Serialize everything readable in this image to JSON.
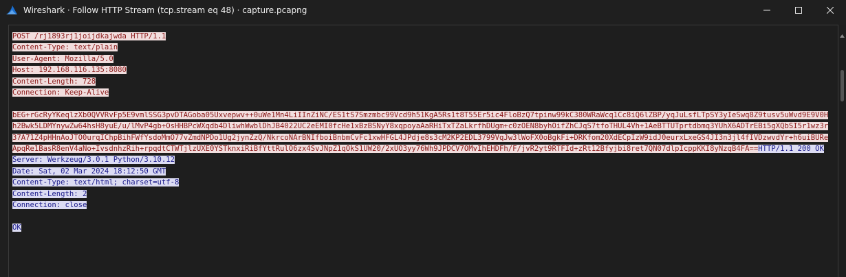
{
  "window": {
    "title": "Wireshark · Follow HTTP Stream (tcp.stream eq 48) · capture.pcapng",
    "icons": {
      "app": "wireshark-fin-icon",
      "minimize": "minimize-icon",
      "maximize": "maximize-icon",
      "close": "close-icon"
    }
  },
  "colors": {
    "client_bg": "#f1dede",
    "client_fg": "#8a1a1a",
    "server_bg": "#dcdcf3",
    "server_fg": "#1b1b8a",
    "window_bg": "#1f1f1f"
  },
  "stream": {
    "request_lines": [
      "POST /rj1893rj1joijdkajwda HTTP/1.1",
      "Content-Type: text/plain",
      "User-Agent: Mozilla/5.0",
      "Host: 192.168.116.135:8080",
      "Content-Length: 728",
      "Connection: Keep-Alive"
    ],
    "request_body": "bEG+rGcRyYKeqlzXb0QVVRvFp5E9vmlSSG3pvDTAGoba05Uxvepwv++0uWe1Mn4LiIInZiNC/ES1tS7Smzmbc99Vcd9h51KgA5Rs1t8T55Er5ic4FloBzQ7tpinw99kC380WRaWcq1Cc8iQ6lZBP/yqJuLsfLTpSY3yIeSwq8Z9tusv5uWvd9E9V0Hh2Bwk5LDMYnywZw64hsH8yuE/u/lMvP4gb+OsHHBPcWXqdb4DliwhWwblDhJB4022UC2eEMI0fcHe1xBzBSNyY8xqpoyaAaRHiTxTZaLkrfhDUgm+c0zOEN8byhOifZhCJqS7tfoTHUL4Vh+1AeBTTUTprtdbmq3YUhX6ADTrEBi5gXQbSI5r1wz3r37A71Z4pHHnAoJTO0urqIChpBihFWfYsdoMmO77vZmdNPDo1Ug2jynZzQ/NkrcoNArBNIfboiBnbmCvFc1xwHFGL4JPdje8s3cM2KP2EDL3799VqJw3lWoFX0oBgkFi+DRKfom20XdECpIzW9idJ0eurxLxeGS4JI3n3jl4fIVDzwvdYr+h6uiBUReApqRe1BasR8enV4aNo+IvsdnhzRih+rpqdtCTWTjlzUXE0YSTknxiRiBfYttRulO6zx4SvJNpZ1qOkS1UW20/2xUO3yy76Wh9JPDCV7OMvIhEHDFh/F/jvR2yt9RTFId+zRt12Bfyjbi8ret7QN07dlpIcppKKI8yNzqB4FA==",
    "response_status": "HTTP/1.1 200 OK",
    "response_lines": [
      "Server: Werkzeug/3.0.1 Python/3.10.12",
      "Date: Sat, 02 Mar 2024 18:12:50 GMT",
      "Content-Type: text/html; charset=utf-8",
      "Content-Length: 2",
      "Connection: close"
    ],
    "response_body": "OK"
  }
}
